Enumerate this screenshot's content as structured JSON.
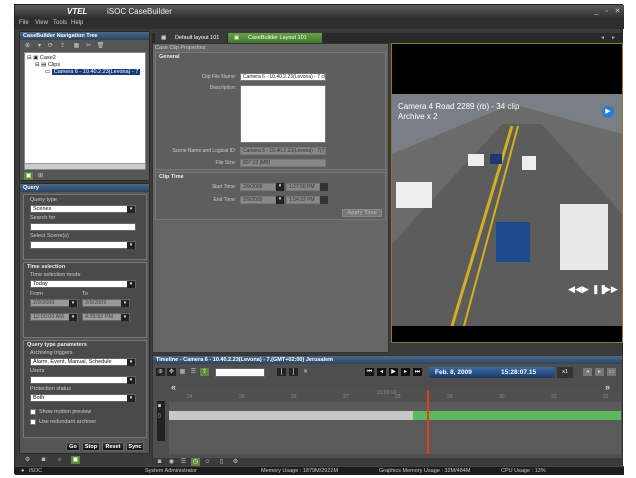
{
  "app": {
    "logo": "VTEL",
    "title": "iSOC CaseBuilder"
  },
  "menu": [
    "File",
    "View",
    "Tools",
    "Help"
  ],
  "tabs": [
    {
      "label": "Default layout 101",
      "active": false
    },
    {
      "label": "CaseBuilder Layout 101",
      "active": true
    }
  ],
  "nav_tree": {
    "title": "CaseBuilder Navigation Tree",
    "items": [
      "Case2",
      "Clips",
      "Camera 6 - 10.40.2.23(Levona) - 7"
    ]
  },
  "query": {
    "title": "Query",
    "query_type_label": "Query type",
    "query_type_value": "Scenes",
    "search_for_label": "Search for",
    "select_scenes_label": "Select Scene(s)",
    "time_selection_title": "Time selection",
    "time_mode_label": "Time selection mode",
    "time_mode_value": "Today",
    "from_label": "From",
    "to_label": "To",
    "from_date": "2/9/2009",
    "from_time": "12:00:00 AM",
    "to_date": "2/9/2009",
    "to_time": "4:35:52 PM",
    "params_title": "Query type parameters",
    "archiving_triggers_label": "Archiving triggers",
    "archiving_triggers_value": "Alarm, Event, Manual, Schedule",
    "users_label": "Users",
    "protection_label": "Protection status",
    "protection_value": "Both",
    "show_motion_label": "Show motion preview",
    "use_redundant_label": "Use redundant archiver",
    "buttons": [
      "Go",
      "Stop",
      "Reset",
      "Sync"
    ]
  },
  "properties": {
    "title": "Case Clip Properties",
    "general_title": "General",
    "clip_file_name_label": "Clip File Name:",
    "clip_file_name_value": "Camera 6 - 10.40.2.23(Levona) - 7 cl",
    "description_label": "Description:",
    "scene_name_label": "Scene Name and Logical ID:",
    "scene_name_value": "Camera 6 - 10.40.2.23(Levona) - 7(7)",
    "file_size_label": "File Size:",
    "file_size_value": "807.23 [MB]",
    "clip_time_title": "Clip Time",
    "start_time_label": "Start Time:",
    "start_date": "2/9/2009",
    "start_time": "1:27:50 PM",
    "end_time_label": "End Time:",
    "end_date": "2/9/2009",
    "end_time": "1:54:22 PM",
    "apply_label": "Apply Time"
  },
  "video": {
    "overlay_line1": "Camera 4 Road 2289 (rb) - 34 clip",
    "overlay_line2": "Archive x 2",
    "road_color": "#5c5c5c"
  },
  "timeline": {
    "title": "Timeline - Camera 6 - 10.40.2.23(Levona) - 7,(GMT+02:00) Jerusalem",
    "date": "Feb. 8, 2009",
    "time": "15:28:07.15",
    "speed": "x1",
    "tick_labels": [
      "24",
      "25",
      "26",
      "27",
      "28",
      "29",
      "30",
      "31",
      "32"
    ],
    "center_label": "15:00:00",
    "playhead_pct": 0.57,
    "recorded_start_pct": 0.54,
    "accent_green": "#5cb85c",
    "playhead_color": "#e04020"
  },
  "status": {
    "app": "iSOC",
    "user": "System Administrator",
    "memory": "Memory Usage : 1879M/2922M",
    "graphics": "Graphics Memory Usage : 32M/484M",
    "cpu": "CPU Usage : 13%"
  }
}
